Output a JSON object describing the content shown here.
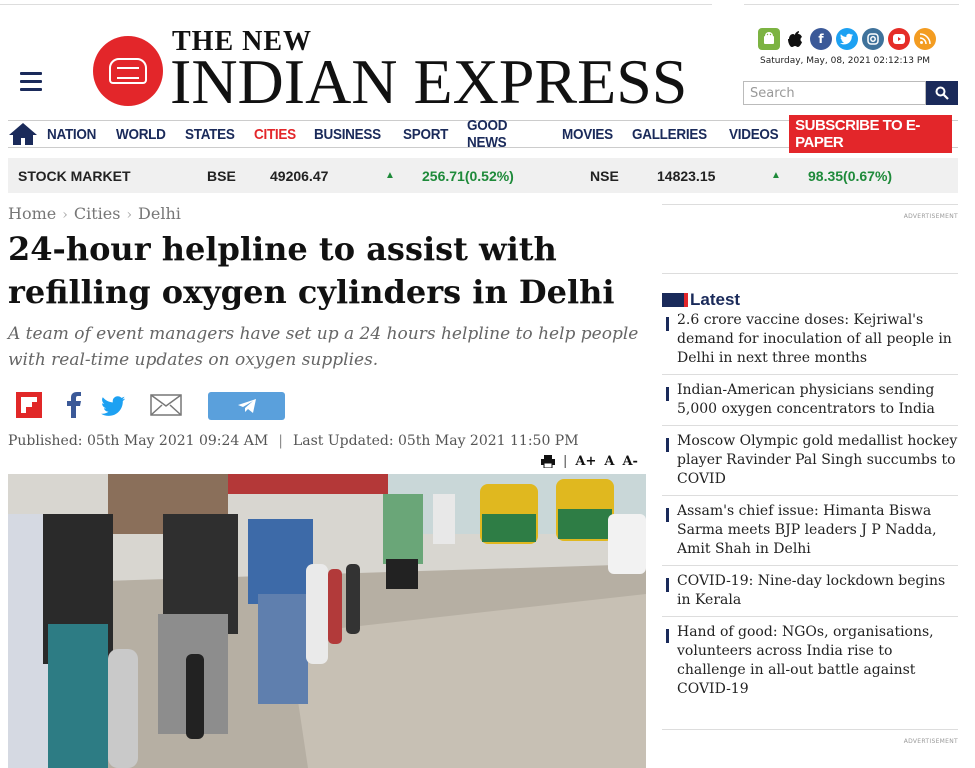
{
  "header": {
    "masthead_top": "THE NEW",
    "masthead_main": "INDIAN EXPRESS",
    "date_time": "Saturday, May, 08, 2021  02:12:13 PM",
    "search_placeholder": "Search",
    "app_icons": [
      "android-icon",
      "apple-icon",
      "facebook-icon",
      "twitter-icon",
      "instagram-icon",
      "youtube-icon",
      "rss-icon"
    ]
  },
  "nav": {
    "items": [
      "NATION",
      "WORLD",
      "STATES",
      "CITIES",
      "BUSINESS",
      "SPORT",
      "GOOD NEWS",
      "MOVIES",
      "GALLERIES",
      "VIDEOS"
    ],
    "active": "CITIES",
    "subscribe": "SUBSCRIBE TO E-PAPER"
  },
  "stock": {
    "label": "STOCK MARKET",
    "bse_label": "BSE",
    "bse_value": "49206.47",
    "bse_change": "256.71(0.52%)",
    "nse_label": "NSE",
    "nse_value": "14823.15",
    "nse_change": "98.35(0.67%)"
  },
  "breadcrumb": [
    "Home",
    "Cities",
    "Delhi"
  ],
  "article": {
    "headline": "24-hour helpline to assist with refilling oxygen cylinders in Delhi",
    "standfirst": "A team of event managers have set up a 24 hours helpline to help people with real-time updates on oxygen supplies.",
    "published": "Published: 05th May 2021 09:24 AM",
    "updated": "Last Updated: 05th May 2021 11:50 PM",
    "font_tools": {
      "increase": "A+",
      "normal": "A",
      "decrease": "A-"
    }
  },
  "sidebar": {
    "ad_label": "ADVERTISEMENT",
    "latest_title": "Latest",
    "latest": [
      "2.6 crore vaccine doses: Kejriwal's demand for inoculation of all people in Delhi in next three months",
      "Indian-American physicians sending 5,000 oxygen concentrators to India",
      "Moscow Olympic gold medallist hockey player Ravinder Pal Singh succumbs to COVID",
      "Assam's chief issue: Himanta Biswa Sarma meets BJP leaders J P Nadda, Amit Shah in Delhi",
      "COVID-19: Nine-day lockdown begins in Kerala",
      "Hand of good: NGOs, organisations, volunteers across India rise to challenge in all-out battle against COVID-19"
    ]
  },
  "colors": {
    "brand_navy": "#1a2a5a",
    "brand_red": "#e3262a",
    "stock_up": "#1e8a3a"
  }
}
